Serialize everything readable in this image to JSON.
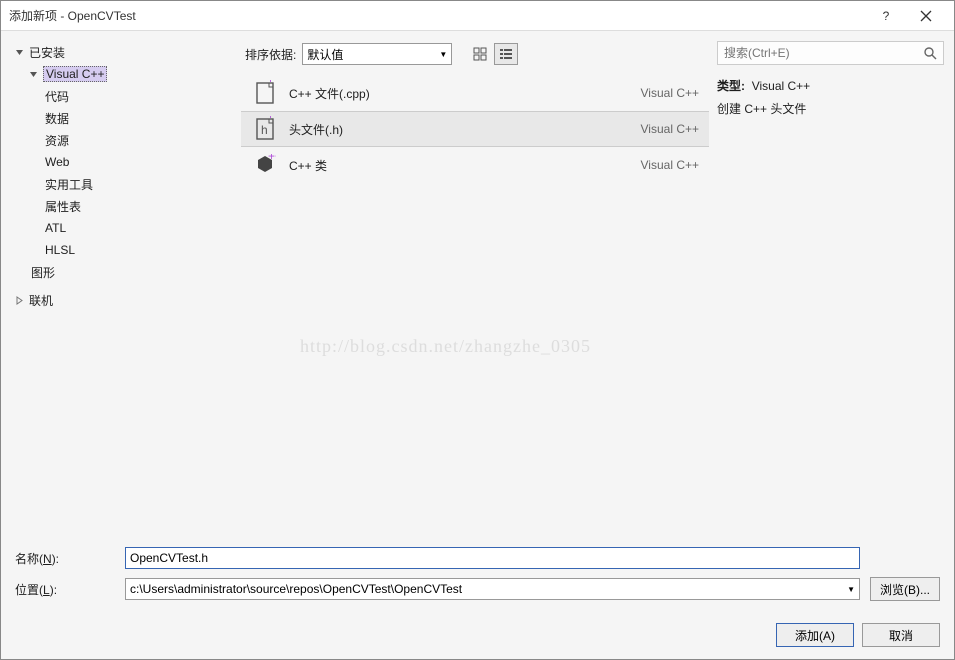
{
  "title": "添加新项 - OpenCVTest",
  "sidebar": {
    "installed": "已安装",
    "vcpp": "Visual C++",
    "children": [
      "代码",
      "数据",
      "资源",
      "Web",
      "实用工具",
      "属性表",
      "ATL",
      "HLSL",
      "图形"
    ],
    "online": "联机"
  },
  "center": {
    "sort_label": "排序依据:",
    "sort_value": "默认值",
    "items": [
      {
        "name": "C++ 文件(.cpp)",
        "lang": "Visual C++"
      },
      {
        "name": "头文件(.h)",
        "lang": "Visual C++"
      },
      {
        "name": "C++ 类",
        "lang": "Visual C++"
      }
    ]
  },
  "right": {
    "search_placeholder": "搜索(Ctrl+E)",
    "type_label": "类型:",
    "type_value": "Visual C++",
    "desc": "创建 C++ 头文件"
  },
  "form": {
    "name_label": "名称(N):",
    "name_label_plain": "名称",
    "name_under": "N",
    "name_value": "OpenCVTest.h",
    "loc_label": "位置(L):",
    "loc_label_plain": "位置",
    "loc_under": "L",
    "loc_value": "c:\\Users\\administrator\\source\\repos\\OpenCVTest\\OpenCVTest",
    "browse": "浏览(B)..."
  },
  "actions": {
    "add": "添加(A)",
    "cancel": "取消"
  },
  "watermark": "http://blog.csdn.net/zhangzhe_0305"
}
